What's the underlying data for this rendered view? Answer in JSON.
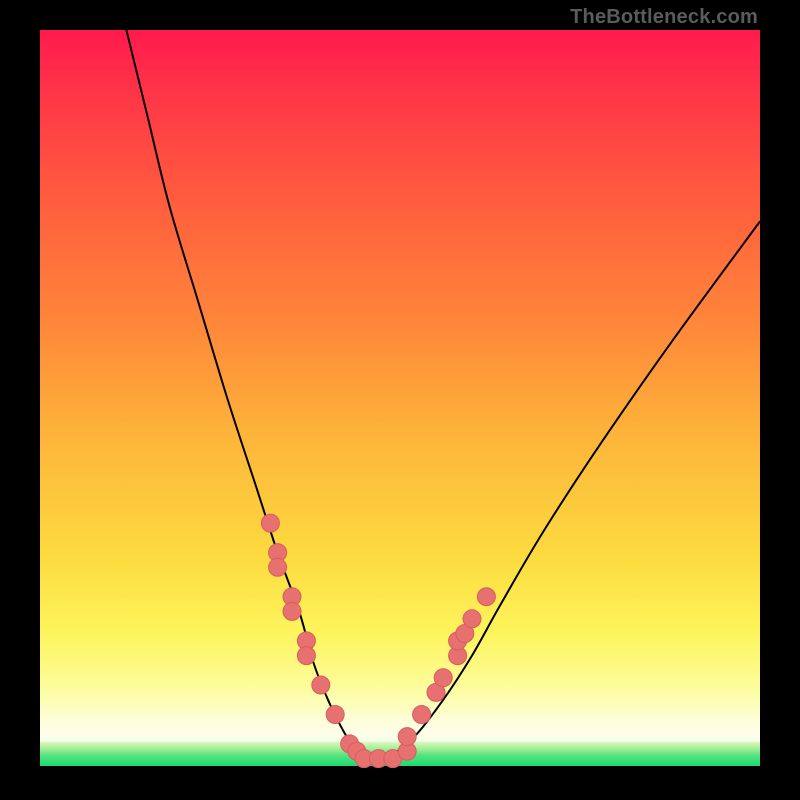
{
  "watermark": "TheBottleneck.com",
  "colors": {
    "background": "#000000",
    "gradient_top": "#ff1a4d",
    "gradient_mid": "#fcdc3f",
    "gradient_bottom": "#fdfff6",
    "green_band": "#0cd968",
    "curve": "#000000",
    "dot_fill": "#e77070",
    "dot_stroke": "#d85d5d"
  },
  "chart_data": {
    "type": "line",
    "title": "",
    "xlabel": "",
    "ylabel": "",
    "xlim": [
      0,
      100
    ],
    "ylim": [
      0,
      100
    ],
    "grid": false,
    "legend": "",
    "series": [
      {
        "name": "bottleneck-curve",
        "x": [
          12,
          15,
          18,
          22,
          26,
          30,
          33,
          36,
          38,
          40,
          42,
          44,
          46,
          48,
          52,
          56,
          60,
          64,
          70,
          78,
          88,
          100
        ],
        "y": [
          100,
          88,
          76,
          63,
          50,
          38,
          29,
          21,
          14,
          9,
          5,
          2,
          1,
          1,
          4,
          9,
          15,
          22,
          32,
          44,
          58,
          74
        ]
      }
    ],
    "markers": [
      {
        "x": 32,
        "y": 33
      },
      {
        "x": 33,
        "y": 29
      },
      {
        "x": 33,
        "y": 27
      },
      {
        "x": 35,
        "y": 23
      },
      {
        "x": 35,
        "y": 21
      },
      {
        "x": 37,
        "y": 17
      },
      {
        "x": 37,
        "y": 15
      },
      {
        "x": 39,
        "y": 11
      },
      {
        "x": 41,
        "y": 7
      },
      {
        "x": 43,
        "y": 3
      },
      {
        "x": 44,
        "y": 2
      },
      {
        "x": 45,
        "y": 1
      },
      {
        "x": 47,
        "y": 1
      },
      {
        "x": 49,
        "y": 1
      },
      {
        "x": 51,
        "y": 2
      },
      {
        "x": 51,
        "y": 4
      },
      {
        "x": 53,
        "y": 7
      },
      {
        "x": 55,
        "y": 10
      },
      {
        "x": 56,
        "y": 12
      },
      {
        "x": 58,
        "y": 15
      },
      {
        "x": 58,
        "y": 17
      },
      {
        "x": 59,
        "y": 18
      },
      {
        "x": 60,
        "y": 20
      },
      {
        "x": 62,
        "y": 23
      }
    ],
    "green_zone_y": [
      0,
      3
    ]
  }
}
